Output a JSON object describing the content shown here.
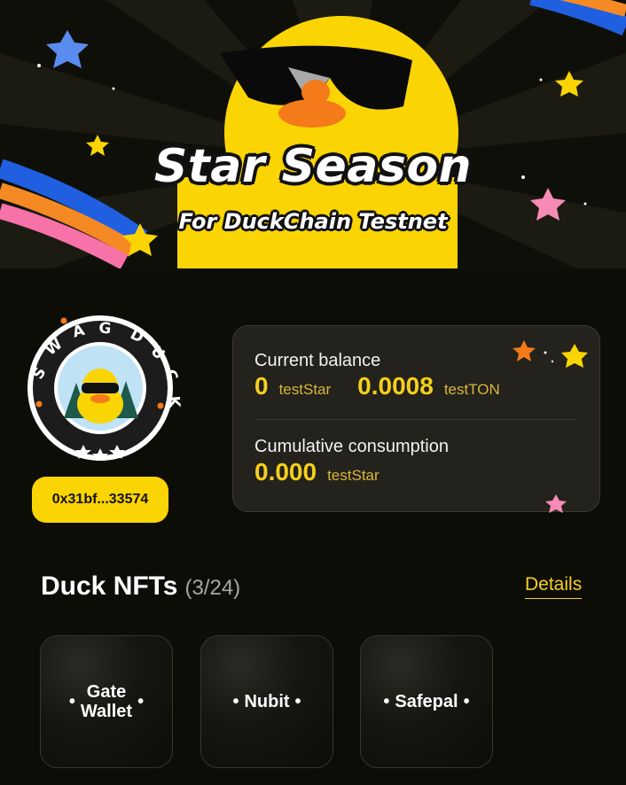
{
  "banner": {
    "title": "Star Season",
    "subtitle": "For DuckChain Testnet"
  },
  "profile": {
    "avatar_ring_text": "SWAG DUCK",
    "address": "0x31bf...33574"
  },
  "balance": {
    "current_label": "Current balance",
    "star_value": "0",
    "star_unit": "testStar",
    "ton_value": "0.0008",
    "ton_unit": "testTON",
    "consumption_label": "Cumulative consumption",
    "consumption_value": "0.000",
    "consumption_unit": "testStar"
  },
  "nfts": {
    "title": "Duck NFTs",
    "count": "(3/24)",
    "details_label": "Details",
    "items": [
      {
        "name": "Gate Wallet",
        "line1": "Gate",
        "line2": "Wallet"
      },
      {
        "name": "Nubit"
      },
      {
        "name": "Safepal"
      }
    ]
  },
  "colors": {
    "accent_yellow": "#fbd403",
    "background": "#0d0d08",
    "card_bg": "#23221c"
  }
}
